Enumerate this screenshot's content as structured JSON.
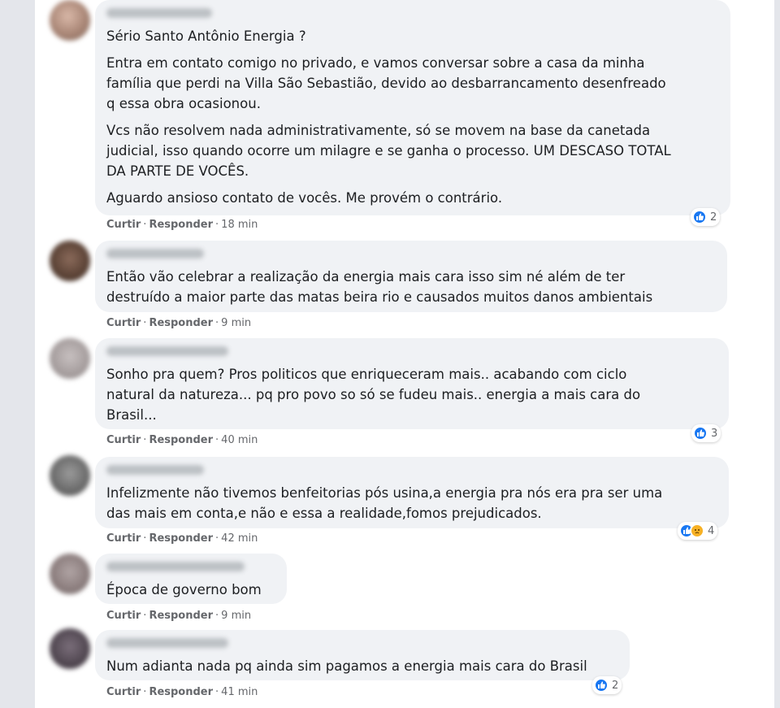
{
  "colors": {
    "like": "#1877f2",
    "sad": "#f7b125",
    "bubble": "#f0f2f5",
    "meta": "#65676b"
  },
  "actions": {
    "like": "Curtir",
    "reply": "Responder"
  },
  "comments": [
    {
      "paragraphs": [
        "Sério Santo Antônio Energia ?",
        "Entra em contato comigo no privado, e vamos conversar sobre a casa da minha\nfamília que perdi na Villa São Sebastião, devido ao desbarrancamento desenfreado\nq essa obra ocasionou.",
        "Vcs não resolvem nada administrativamente, só se movem na base da canetada\njudicial, isso quando ocorre um milagre e se ganha o processo. UM DESCASO TOTAL\nDA PARTE DE VOCÊS.",
        "Aguardo ansioso contato de vocês. Me provém o contrário."
      ],
      "time": "18 min",
      "reactions": {
        "types": [
          "like"
        ],
        "count": "2"
      }
    },
    {
      "paragraphs": [
        "Então vão celebrar a realização da energia mais cara isso sim né além de ter\ndestruído a maior parte das matas beira rio e causados muitos danos ambientais"
      ],
      "time": "9 min"
    },
    {
      "paragraphs": [
        "Sonho pra quem? Pros politicos que enriqueceram mais.. acabando com ciclo\nnatural da natureza... pq pro povo so só se fudeu mais.. energia a mais cara do\nBrasil..."
      ],
      "time": "40 min",
      "reactions": {
        "types": [
          "like"
        ],
        "count": "3"
      }
    },
    {
      "paragraphs": [
        "Infelizmente não tivemos benfeitorias pós usina,a energia pra nós era pra ser uma\ndas mais em conta,e não e essa a realidade,fomos prejudicados."
      ],
      "time": "42 min",
      "reactions": {
        "types": [
          "like",
          "sad"
        ],
        "count": "4"
      }
    },
    {
      "paragraphs": [
        "Época de governo bom"
      ],
      "time": "9 min"
    },
    {
      "paragraphs": [
        "Num adianta nada pq ainda sim pagamos a energia mais cara do Brasil"
      ],
      "time": "41 min",
      "reactions": {
        "types": [
          "like"
        ],
        "count": "2"
      }
    }
  ]
}
